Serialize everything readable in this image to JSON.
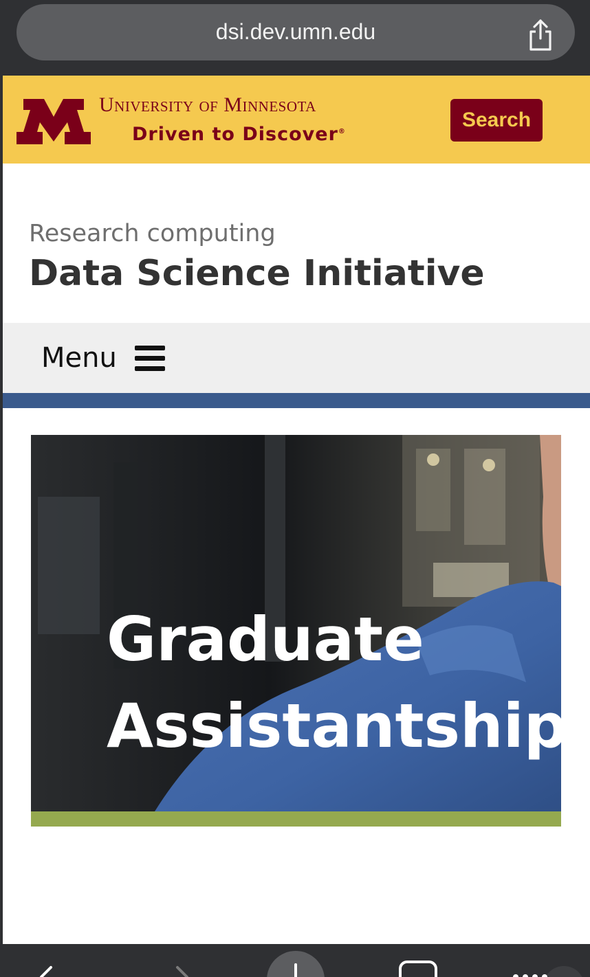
{
  "browser": {
    "url": "dsi.dev.umn.edu",
    "share_icon": "share-icon",
    "toolbar_icons": [
      "back-icon",
      "forward-icon",
      "new-tab-icon",
      "tabs-icon",
      "more-icon"
    ]
  },
  "umn_header": {
    "logo_icon": "umn-block-m-logo",
    "university_name": "University of Minnesota",
    "tagline": "Driven to Discover",
    "tagline_mark": "®",
    "search_label": "Search",
    "colors": {
      "gold": "#f5c94f",
      "maroon": "#7a0019"
    }
  },
  "site": {
    "subtitle": "Research computing",
    "title": "Data Science Initiative"
  },
  "nav": {
    "menu_label": "Menu",
    "menu_icon": "hamburger-icon",
    "rule_color": "#3a5a8c"
  },
  "hero": {
    "line1": "Graduate",
    "line2": "Assistantships",
    "accent_color": "#95a94f"
  }
}
